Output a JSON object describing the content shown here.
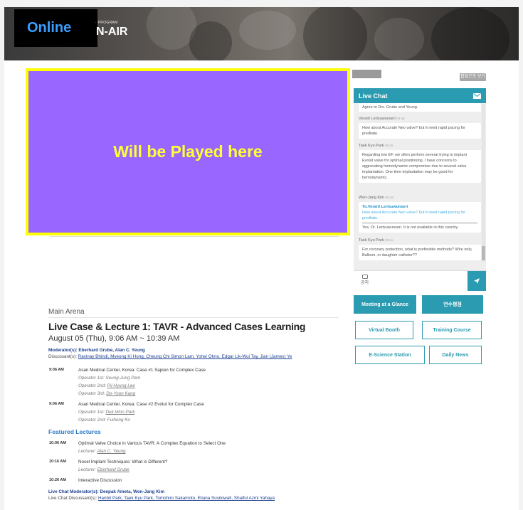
{
  "banner": {
    "online_label": "Online",
    "small_label": "· PROGRAM",
    "title": "N-AIR"
  },
  "video": {
    "placeholder": "Will be Played here"
  },
  "popout_label": "팝업으로 보기",
  "chat": {
    "title": "Live Chat",
    "messages": [
      {
        "author": "",
        "time": "",
        "text": "Agree to Drs. Grube and Yeung."
      },
      {
        "author": "Vorarit Lertsuwunseri",
        "time": "09:48",
        "text": "How about Accurate Neo valve? but it need rapid pacing for predilate."
      },
      {
        "author": "Taek Kyu Park",
        "time": "09:49",
        "text": "Regarding low EF, we often perform several trying to implant Evolut valve for optimal positioning. I have concerns to aggravating hemodynamic compromise due to several valve implantation. One time implantation may be good for hemodynamic."
      },
      {
        "author": "Won-Jang Kim",
        "time": "09:49",
        "to": "To.Vorarit Lertsuwunseri",
        "quote": "How about Accurate Neo valve? but it need rapid pacing for predilate.",
        "text": "Yes, Dr. Lertsuwunseri. It is not available in this country."
      },
      {
        "author": "Taek Kyu Park",
        "time": "09:51",
        "text": "For coronary protection, what is preferable methods? Wire only, Balloon, or daughter catheter??"
      }
    ],
    "notice_label": "공지"
  },
  "buttons": {
    "meeting_at_a_glance": "Meeting at a Glance",
    "training_points": "연수평점",
    "virtual_booth": "Virtual Booth",
    "training_course": "Training Course",
    "e_science_station": "E-Science Station",
    "daily_news": "Daily News"
  },
  "session": {
    "arena": "Main Arena",
    "title": "Live Case & Lecture 1: TAVR - Advanced Cases Learning",
    "date": "August 05 (Thu), 9:06 AM ~ 10:39 AM",
    "moderators_label": "Moderator(s):",
    "moderators": "Eberhard Grube, Alan C. Yeung",
    "discussants_label": "Discussant(s):",
    "discussants": "Ravinay Bhindi, Myeong Ki Hong, Cheung Chi Simon Lam, Yohei Ohno, Edgar Lik-Wui Tay, Jian (James) Ye",
    "cases": [
      {
        "time": "9:06 AM",
        "title": "Asan Medical Center, Korea: Case #1 Sapien for Complex Case",
        "operators": [
          {
            "role": "Operator 1st:",
            "name": "Seung-Jung Park"
          },
          {
            "role": "Operator 2nd:",
            "name": "Pil Hyung Lee"
          },
          {
            "role": "Operator 3rd:",
            "name": "Do-Yoon Kang"
          }
        ]
      },
      {
        "time": "9:06 AM",
        "title": "Asan Medical Center, Korea: Case #2 Evolut for Complex Case",
        "operators": [
          {
            "role": "Operator 1st:",
            "name": "Duk-Woo Park"
          },
          {
            "role": "Operator 2nd:",
            "name": "Fuihong Ko"
          }
        ]
      }
    ],
    "featured_label": "Featured Lectures",
    "lectures": [
      {
        "time": "10:06 AM",
        "title": "Optimal Valve Choice in Various TAVR: A Complex Equation to Select One",
        "lecturer_label": "Lecturer:",
        "lecturer": "Alan C. Yeung"
      },
      {
        "time": "10:16 AM",
        "title": "Novel Implant Techniques: What is Different?",
        "lecturer_label": "Lecturer:",
        "lecturer": "Eberhard Grube"
      },
      {
        "time": "10:26 AM",
        "title": "Interactive Discussion"
      }
    ],
    "live_chat_moderators_label": "Live Chat Moderator(s):",
    "live_chat_moderators": "Deepak Ameta, Won-Jang Kim",
    "live_chat_discussants_label": "Live Chat Discussant(s):",
    "live_chat_discussants": "Hanbit Park, Taek Kyu Park, Tomohiro Sakamoto, Eliana Susilowati, Shaiful Azmi Yahaya"
  },
  "colors": {
    "teal": "#2a9bb0",
    "video_purple": "#9966ff",
    "video_border": "#ffff00",
    "link_blue": "#1b3e8f"
  },
  "icons": {
    "chat_mail": "envelope-icon",
    "send": "send-icon",
    "notice": "notice-icon"
  }
}
